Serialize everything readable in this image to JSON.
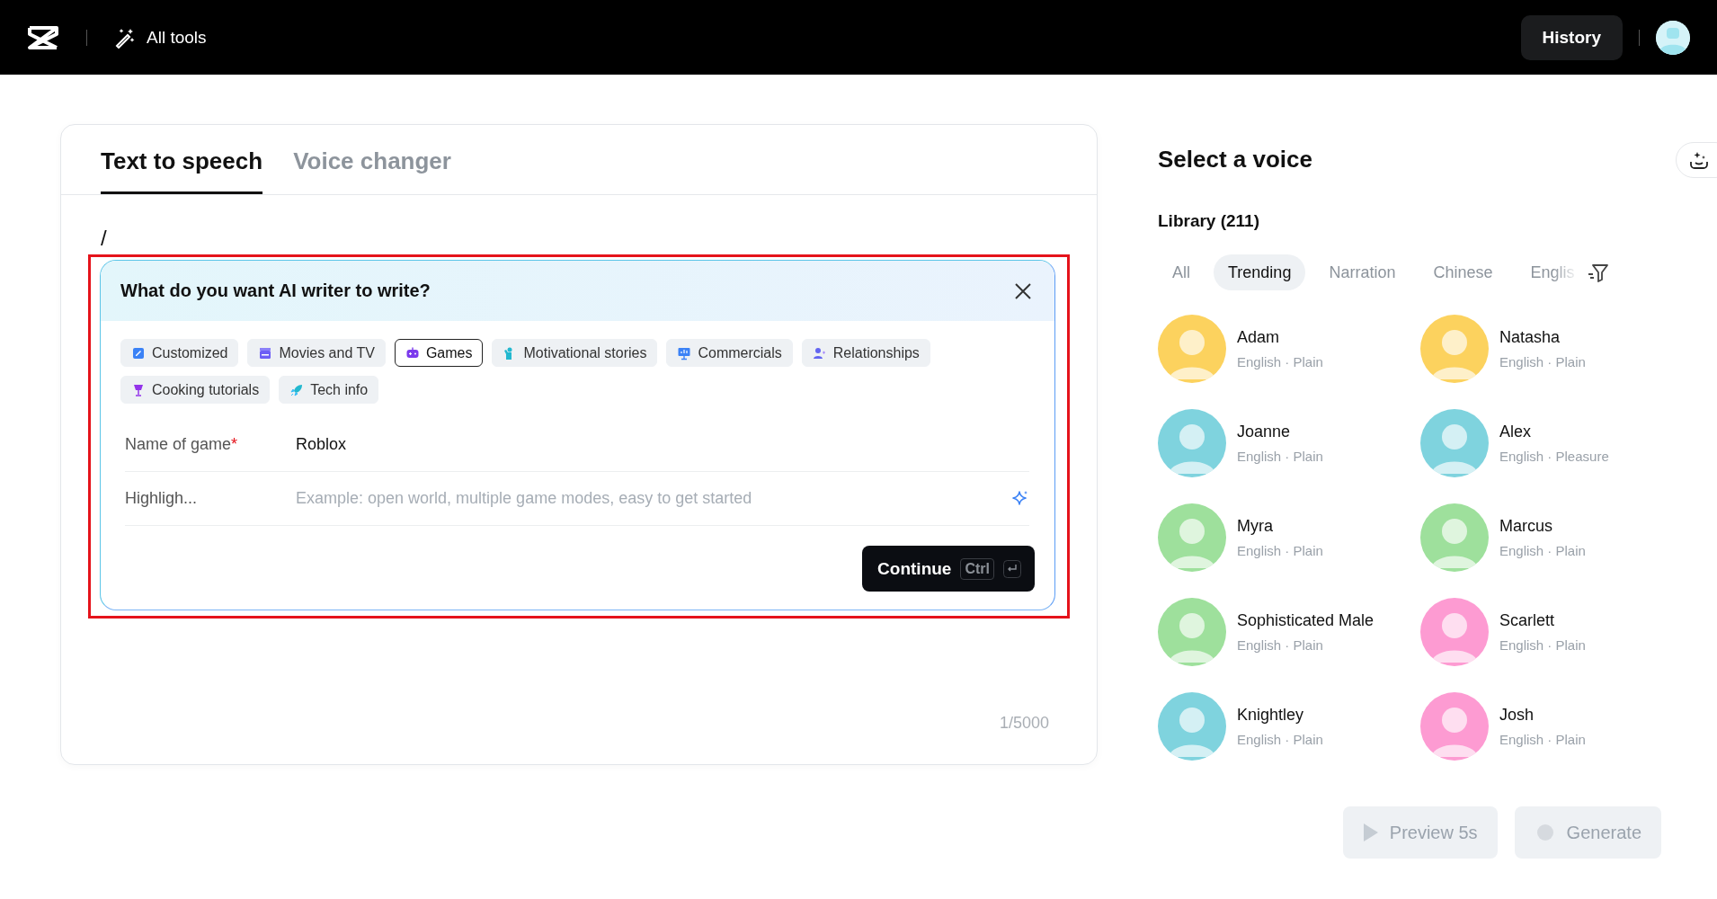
{
  "topbar": {
    "tools_label": "All tools",
    "history_button": "History"
  },
  "editor": {
    "tabs": [
      {
        "label": "Text to speech",
        "selected": true
      },
      {
        "label": "Voice changer",
        "selected": false
      }
    ],
    "text": "/",
    "ai_writer": {
      "highlighted": true,
      "title": "What do you want AI writer to write?",
      "categories": [
        {
          "label": "Customized",
          "kind": "note",
          "selected": false
        },
        {
          "label": "Movies and TV",
          "kind": "clapper",
          "selected": false
        },
        {
          "label": "Games",
          "kind": "gamepad",
          "selected": true
        },
        {
          "label": "Motivational stories",
          "kind": "person",
          "selected": false
        },
        {
          "label": "Commercials",
          "kind": "screen",
          "selected": false
        },
        {
          "label": "Relationships",
          "kind": "people",
          "selected": false
        },
        {
          "label": "Cooking tutorials",
          "kind": "cup",
          "selected": false
        },
        {
          "label": "Tech info",
          "kind": "rocket",
          "selected": false
        }
      ],
      "fields": [
        {
          "label": "Name of game",
          "required_mark": "*",
          "kind": "plain",
          "value": "Roblox"
        },
        {
          "label": "Highligh...",
          "kind": "assist",
          "placeholder": "Example: open world, multiple game modes, easy to get started"
        }
      ],
      "continue_button": {
        "label": "Continue",
        "shortcut": "Ctrl"
      }
    },
    "char_count": "1/5000"
  },
  "voice_panel": {
    "title": "Select a voice",
    "library": "Library (211)",
    "filters": [
      {
        "label": "All",
        "selected": false
      },
      {
        "label": "Trending",
        "selected": true
      },
      {
        "label": "Narration",
        "selected": false
      },
      {
        "label": "Chinese",
        "selected": false
      },
      {
        "label": "Englis",
        "selected": false
      }
    ],
    "voices": [
      {
        "name": "Adam",
        "meta": "English · Plain",
        "color": "#fcd25e"
      },
      {
        "name": "Natasha",
        "meta": "English · Plain",
        "color": "#fcd25e"
      },
      {
        "name": "Joanne",
        "meta": "English · Plain",
        "color": "#7fd3de"
      },
      {
        "name": "Alex",
        "meta": "English · Pleasure",
        "color": "#7fd3de"
      },
      {
        "name": "Myra",
        "meta": "English · Plain",
        "color": "#9ee09c"
      },
      {
        "name": "Marcus",
        "meta": "English · Plain",
        "color": "#9ee09c"
      },
      {
        "name": "Sophisticated Male",
        "meta": "English · Plain",
        "color": "#9ee09c"
      },
      {
        "name": "Scarlett",
        "meta": "English · Plain",
        "color": "#fd9bd2"
      },
      {
        "name": "Knightley",
        "meta": "English · Plain",
        "color": "#7fd3de"
      },
      {
        "name": "Josh",
        "meta": "English · Plain",
        "color": "#fd9bd2"
      }
    ],
    "actions": [
      {
        "label": "Preview 5s",
        "kind": "preview",
        "disabled": true
      },
      {
        "label": "Generate",
        "kind": "generate",
        "disabled": true
      }
    ]
  }
}
